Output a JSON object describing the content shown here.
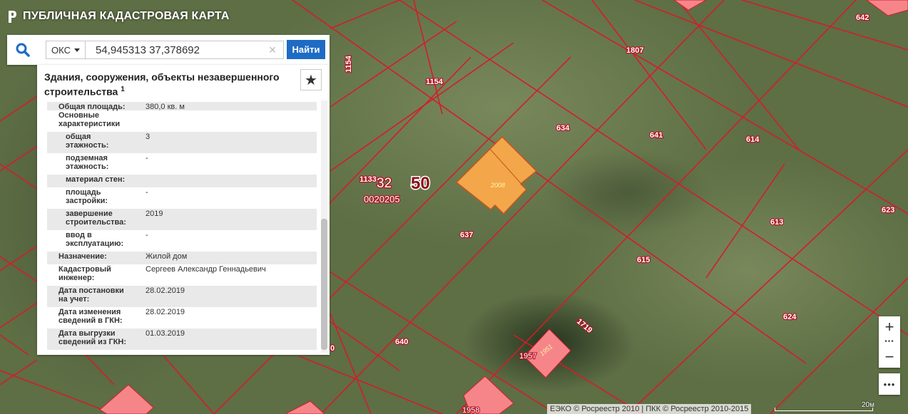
{
  "header": {
    "title": "ПУБЛИЧНАЯ КАДАСТРОВАЯ КАРТА"
  },
  "search": {
    "type_selected": "ОКС",
    "query": "54,945313 37,378692",
    "find_label": "Найти"
  },
  "panel": {
    "title": "Здания, сооружения, объекты незавершенного строительства",
    "title_note": "1",
    "rows": [
      {
        "key": "Общая площадь:",
        "value": "380,0 кв. м",
        "sub": false
      },
      {
        "key": "Основные характеристики",
        "value": "",
        "sub": false
      },
      {
        "key": "общая этажность:",
        "value": "3",
        "sub": true
      },
      {
        "key": "подземная этажность:",
        "value": "-",
        "sub": true
      },
      {
        "key": "материал стен:",
        "value": "",
        "sub": true
      },
      {
        "key": "площадь застройки:",
        "value": "-",
        "sub": true
      },
      {
        "key": "завершение строительства:",
        "value": "2019",
        "sub": true
      },
      {
        "key": "ввод в эксплуатацию:",
        "value": "-",
        "sub": true
      },
      {
        "key": "Назначение:",
        "value": "Жилой дом",
        "sub": false
      },
      {
        "key": "Кадастровый инженер:",
        "value": "Сергеев Александр Геннадьевич",
        "sub": false
      },
      {
        "key": "Дата постановки на учет:",
        "value": "28.02.2019",
        "sub": false
      },
      {
        "key": "Дата изменения сведений в ГКН:",
        "value": "28.02.2019",
        "sub": false
      },
      {
        "key": "Дата выгрузки сведений из ГКН:",
        "value": "01.03.2019",
        "sub": false
      }
    ]
  },
  "map": {
    "parcel_labels": [
      "1807",
      "642",
      "1154",
      "1154",
      "634",
      "641",
      "614",
      "1133",
      "32",
      "0020205",
      "50",
      "2008",
      "637",
      "613",
      "623",
      "615",
      "624",
      "1719",
      "640",
      "1957",
      "1958",
      "1951",
      "0"
    ],
    "colors": {
      "parcel_line": "#d21e2a",
      "building_fill": "#f3a64a",
      "building_stroke": "#c4561c",
      "other_building_fill": "#f6858a"
    }
  },
  "zoom": {
    "in_label": "+",
    "out_label": "−",
    "dots": "•••",
    "more": "•••"
  },
  "attribution": "ЕЭКО © Росреестр 2010 | ПКК © Росреестр 2010-2015",
  "scale_label": "20м"
}
